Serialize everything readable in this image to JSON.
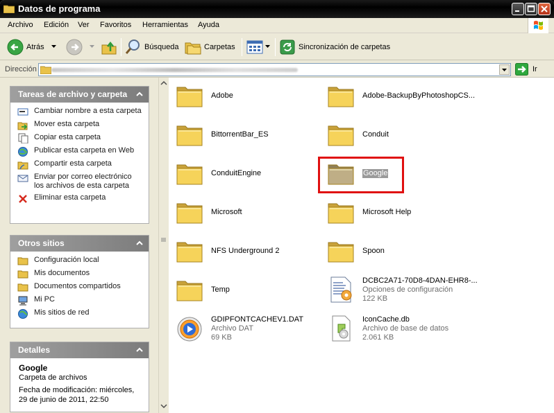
{
  "window": {
    "title": "Datos de programa"
  },
  "menu": [
    "Archivo",
    "Edición",
    "Ver",
    "Favoritos",
    "Herramientas",
    "Ayuda"
  ],
  "toolbar": {
    "back": "Atrás",
    "search": "Búsqueda",
    "folders": "Carpetas",
    "sync": "Sincronización de carpetas"
  },
  "address": {
    "label": "Dirección",
    "go": "Ir"
  },
  "tasks_panel": {
    "title": "Tareas de archivo y carpeta",
    "items": [
      {
        "label": "Cambiar nombre a esta carpeta",
        "icon": "rename-icon"
      },
      {
        "label": "Mover esta carpeta",
        "icon": "move-icon"
      },
      {
        "label": "Copiar esta carpeta",
        "icon": "copy-icon"
      },
      {
        "label": "Publicar esta carpeta en Web",
        "icon": "publish-web-icon"
      },
      {
        "label": "Compartir esta carpeta",
        "icon": "share-folder-icon"
      },
      {
        "label": "Enviar por correo electrónico los archivos de esta carpeta",
        "icon": "email-icon"
      },
      {
        "label": "Eliminar esta carpeta",
        "icon": "delete-icon"
      }
    ]
  },
  "places_panel": {
    "title": "Otros sitios",
    "items": [
      {
        "label": "Configuración local",
        "icon": "folder-icon"
      },
      {
        "label": "Mis documentos",
        "icon": "folder-icon"
      },
      {
        "label": "Documentos compartidos",
        "icon": "folder-icon"
      },
      {
        "label": "Mi PC",
        "icon": "computer-icon"
      },
      {
        "label": "Mis sitios de red",
        "icon": "network-icon"
      }
    ]
  },
  "details_panel": {
    "title": "Detalles",
    "name": "Google",
    "type": "Carpeta de archivos",
    "modified_line1": "Fecha de modificación: miércoles,",
    "modified_line2": "29 de junio de 2011, 22:50"
  },
  "files": [
    {
      "name": "Adobe",
      "kind": "folder"
    },
    {
      "name": "Adobe-BackupByPhotoshopCS...",
      "kind": "folder"
    },
    {
      "name": "BittorrentBar_ES",
      "kind": "folder"
    },
    {
      "name": "Conduit",
      "kind": "folder"
    },
    {
      "name": "ConduitEngine",
      "kind": "folder"
    },
    {
      "name": "Google",
      "kind": "folder",
      "selected": true
    },
    {
      "name": "Microsoft",
      "kind": "folder"
    },
    {
      "name": "Microsoft Help",
      "kind": "folder"
    },
    {
      "name": "NFS Underground 2",
      "kind": "folder"
    },
    {
      "name": "Spoon",
      "kind": "folder"
    },
    {
      "name": "Temp",
      "kind": "folder"
    },
    {
      "name": "DCBC2A71-70D8-4DAN-EHR8-...",
      "kind": "config",
      "type": "Opciones de configuración",
      "size": "122 KB"
    },
    {
      "name": "GDIPFONTCACHEV1.DAT",
      "kind": "dat",
      "type": "Archivo DAT",
      "size": "69 KB"
    },
    {
      "name": "IconCache.db",
      "kind": "db",
      "type": "Archivo de base de datos",
      "size": "2.061 KB"
    }
  ],
  "colors": {
    "selection_outline": "#e01010",
    "folder_yellow": "#f6d35a"
  }
}
